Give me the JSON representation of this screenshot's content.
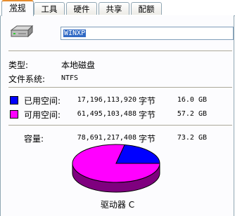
{
  "tabs": [
    {
      "label": "常规",
      "active": true
    },
    {
      "label": "工具",
      "active": false
    },
    {
      "label": "硬件",
      "active": false
    },
    {
      "label": "共享",
      "active": false
    },
    {
      "label": "配额",
      "active": false
    }
  ],
  "drive": {
    "name": "WINXP",
    "icon": "hard-drive-icon",
    "type_label": "类型:",
    "type_value": "本地磁盘",
    "fs_label": "文件系统:",
    "fs_value": "NTFS",
    "drive_label": "驱动器 C"
  },
  "usage": {
    "used": {
      "label": "已用空间:",
      "bytes": "17,196,113,920",
      "unit": "字节",
      "size": "16.0 GB",
      "color": "#0000ff"
    },
    "free": {
      "label": "可用空间:",
      "bytes": "61,495,103,488",
      "unit": "字节",
      "size": "57.2 GB",
      "color": "#ff00ff"
    },
    "capacity": {
      "label": "容量:",
      "bytes": "78,691,217,408",
      "unit": "字节",
      "size": "73.2 GB"
    }
  },
  "pie": {
    "used_fraction": 0.2185,
    "used_color": "#0000ff",
    "free_color": "#ff00ff",
    "used_side_color": "#00007f",
    "free_side_color": "#7f007f"
  }
}
